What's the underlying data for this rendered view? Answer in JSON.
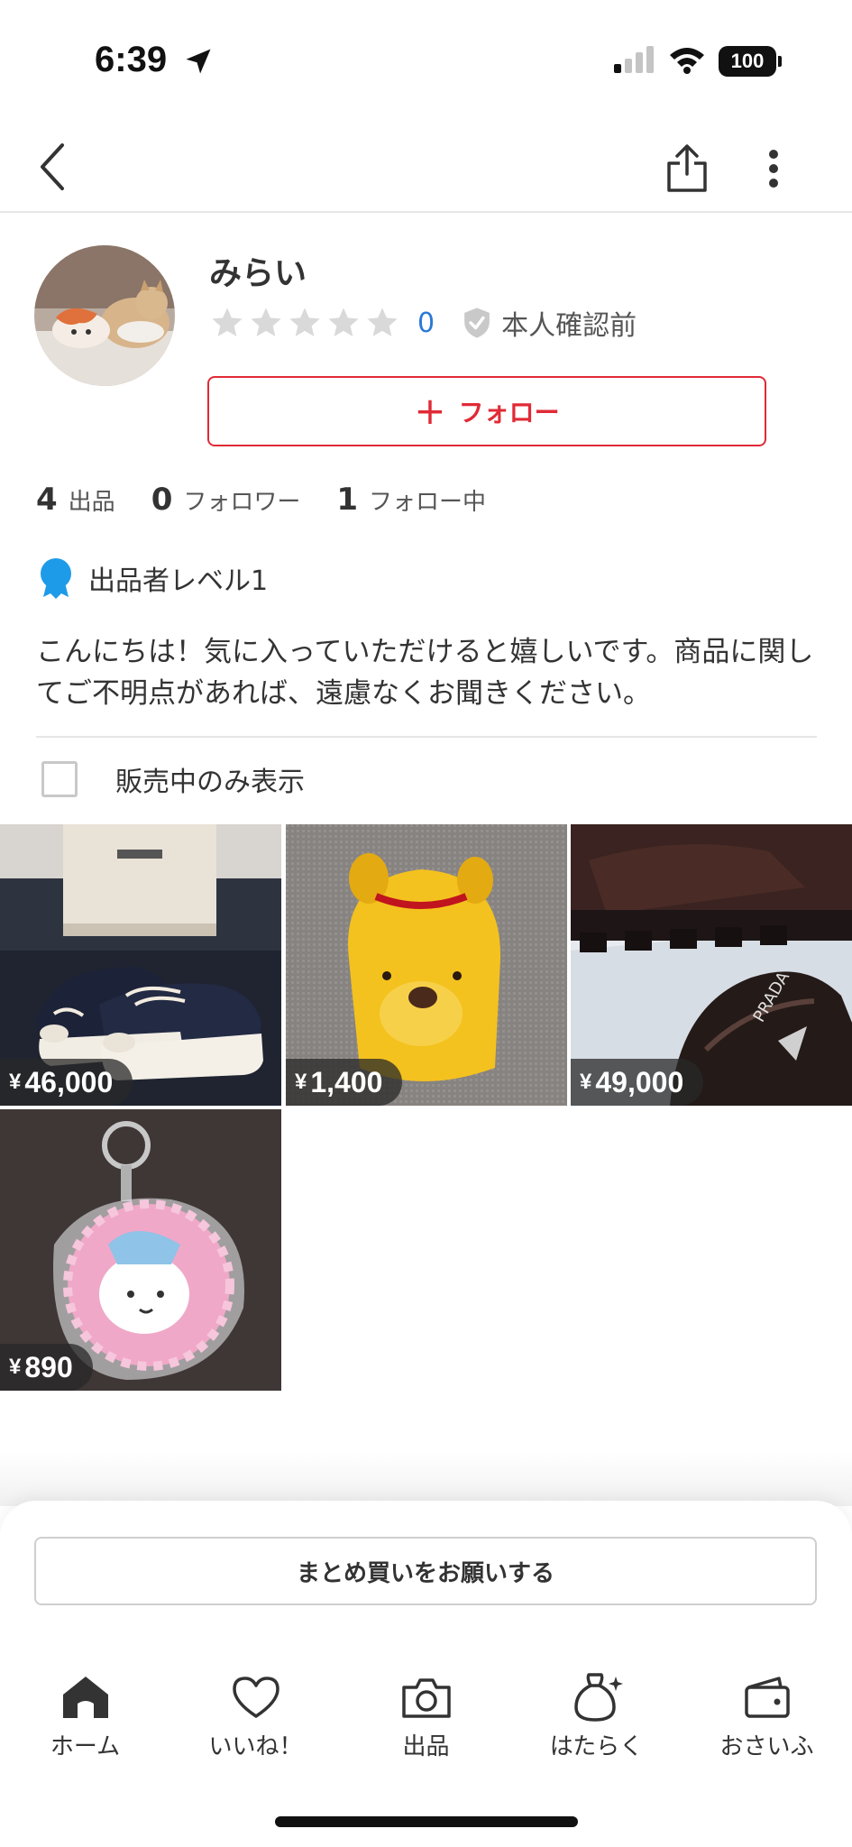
{
  "status_bar": {
    "time": "6:39",
    "battery": "100"
  },
  "profile": {
    "name": "みらい",
    "rating_count": "0",
    "verification": "本人確認前",
    "follow_label": "フォロー",
    "stats": [
      {
        "num": "4",
        "label": "出品"
      },
      {
        "num": "0",
        "label": "フォロワー"
      },
      {
        "num": "1",
        "label": "フォロー中"
      }
    ],
    "level": "出品者レベル1",
    "bio": "こんにちは！気に入っていただけると嬉しいです。商品に関してご不明点があれば、遠慮なくお聞きください。"
  },
  "filter": {
    "label": "販売中のみ表示",
    "checked": false
  },
  "items": [
    {
      "yen": "¥",
      "price": "46,000"
    },
    {
      "yen": "¥",
      "price": "1,400"
    },
    {
      "yen": "¥",
      "price": "49,000"
    },
    {
      "yen": "¥",
      "price": "890"
    }
  ],
  "sheet": {
    "bundle_label": "まとめ買いをお願いする"
  },
  "tabs": [
    {
      "label": "ホーム",
      "icon": "home-icon"
    },
    {
      "label": "いいね！",
      "icon": "heart-icon"
    },
    {
      "label": "出品",
      "icon": "camera-icon"
    },
    {
      "label": "はたらく",
      "icon": "money-bag-icon"
    },
    {
      "label": "おさいふ",
      "icon": "wallet-icon"
    }
  ],
  "colors": {
    "accent": "#e02a36",
    "link": "#2a7ad6",
    "level_badge": "#1e9be8"
  }
}
